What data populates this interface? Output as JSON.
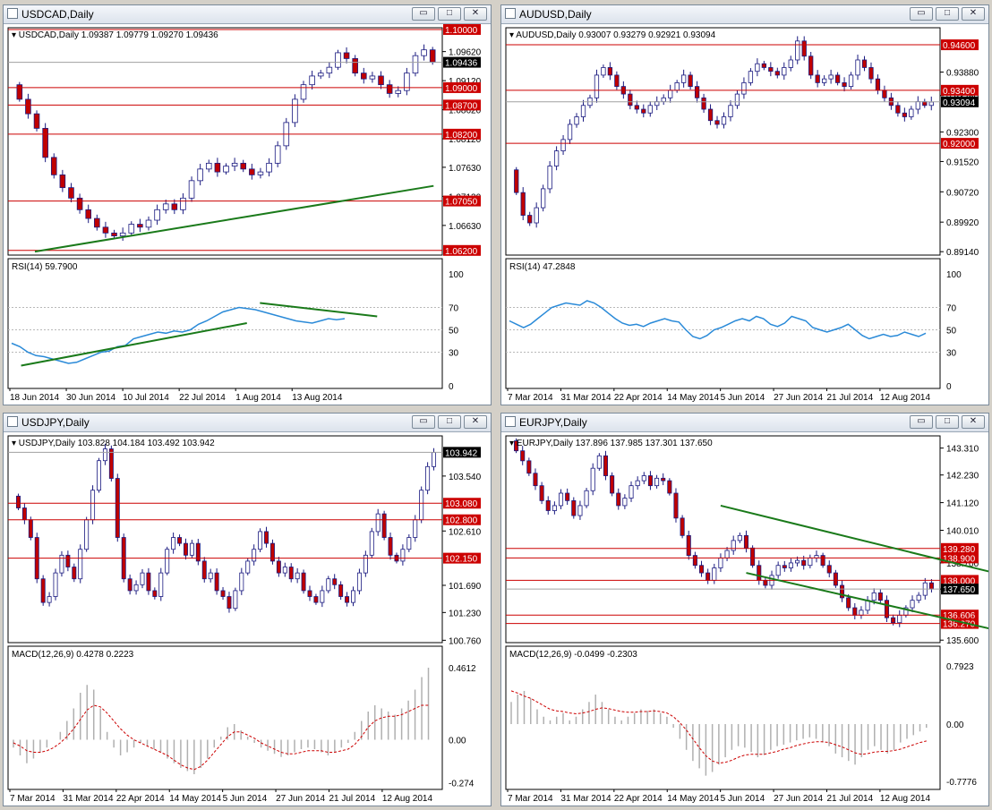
{
  "colors": {
    "level": "#cc0000",
    "bull_fill": "#ffffff",
    "bear_fill": "#c00000",
    "candle_stroke": "#1a1a80",
    "trend": "#1a7a1a",
    "rsi": "#2a8ad8",
    "signal": "#cc0000",
    "hist": "#b0b0b0",
    "price_label_bg": "#000000"
  },
  "window_buttons": {
    "minimize": "▭",
    "maximize": "□",
    "close": "✕"
  },
  "panels": [
    {
      "id": "usdcad",
      "title": "USDCAD,Daily",
      "legend": "USDCAD,Daily  1.09387 1.09779 1.09270 1.09436",
      "price_range": [
        1.0612,
        1.1003
      ],
      "ticks": [
        "1.09620",
        "1.09120",
        "1.08620",
        "1.08120",
        "1.07630",
        "1.07130",
        "1.06630"
      ],
      "tick_values": [
        1.0962,
        1.0912,
        1.0862,
        1.0812,
        1.0763,
        1.0713,
        1.0663
      ],
      "levels": [
        {
          "label": "1.10000",
          "value": 1.1
        },
        {
          "label": "1.09000",
          "value": 1.09
        },
        {
          "label": "1.08700",
          "value": 1.087
        },
        {
          "label": "1.08200",
          "value": 1.082
        },
        {
          "label": "1.07050",
          "value": 1.0705
        },
        {
          "label": "1.06200",
          "value": 1.062
        }
      ],
      "current": {
        "label": "1.09436",
        "value": 1.09436
      },
      "path": [
        1.088,
        1.0855,
        1.083,
        1.078,
        1.075,
        1.0728,
        1.071,
        1.069,
        1.0675,
        1.066,
        1.065,
        1.0645,
        1.065,
        1.0665,
        1.066,
        1.0672,
        1.069,
        1.07,
        1.069,
        1.071,
        1.074,
        1.076,
        1.077,
        1.0755,
        1.0765,
        1.077,
        1.076,
        1.075,
        1.0755,
        1.077,
        1.08,
        1.084,
        1.088,
        1.0905,
        1.092,
        1.0925,
        1.0935,
        1.096,
        1.095,
        1.0925,
        1.0915,
        1.092,
        1.0905,
        1.089,
        1.0895,
        1.0925,
        1.0955,
        1.0965,
        1.0944
      ],
      "trendlines": [
        {
          "p1": [
            5,
            1.0618
          ],
          "p2": [
            80,
            1.0731
          ]
        },
        {
          "p1": [
            0.03,
            "rsi",
            18
          ],
          "p2": [
            0.55,
            "rsi",
            56
          ],
          "sub": true
        },
        {
          "p1": [
            0.58,
            "rsi",
            74
          ],
          "p2": [
            0.85,
            "rsi",
            62
          ],
          "sub": true
        }
      ],
      "dates": [
        "18 Jun 2014",
        "30 Jun 2014",
        "10 Jul 2014",
        "22 Jul 2014",
        "1 Aug 2014",
        "13 Aug 2014"
      ],
      "sub": {
        "type": "rsi",
        "legend": "RSI(14) 59.7900",
        "ticks": [
          "100",
          "70",
          "50",
          "30",
          "0"
        ],
        "range": [
          0,
          100
        ],
        "values": [
          38,
          35,
          30,
          27,
          26,
          24,
          22,
          20,
          21,
          24,
          27,
          30,
          31,
          35,
          36,
          42,
          44,
          46,
          48,
          47,
          49,
          48,
          50,
          55,
          58,
          62,
          66,
          68,
          70,
          69,
          68,
          66,
          64,
          62,
          60,
          58,
          57,
          56,
          58,
          60,
          59,
          60
        ]
      }
    },
    {
      "id": "audusd",
      "title": "AUDUSD,Daily",
      "legend": "AUDUSD,Daily  0.93007 0.93279 0.92921 0.93094",
      "price_range": [
        0.8905,
        0.9505
      ],
      "ticks": [
        "0.93880",
        "0.93260",
        "0.92300",
        "0.91520",
        "0.90720",
        "0.89920",
        "0.89140"
      ],
      "tick_values": [
        0.9388,
        0.9326,
        0.923,
        0.9152,
        0.9072,
        0.8992,
        0.8914
      ],
      "levels": [
        {
          "label": "0.94600",
          "value": 0.946
        },
        {
          "label": "0.93400",
          "value": 0.934
        },
        {
          "label": "0.92000",
          "value": 0.92
        }
      ],
      "current": {
        "label": "0.93094",
        "value": 0.93094
      },
      "path": [
        0.907,
        0.901,
        0.899,
        0.903,
        0.908,
        0.914,
        0.918,
        0.921,
        0.925,
        0.927,
        0.93,
        0.932,
        0.938,
        0.94,
        0.938,
        0.935,
        0.933,
        0.93,
        0.929,
        0.928,
        0.93,
        0.931,
        0.932,
        0.934,
        0.936,
        0.938,
        0.935,
        0.932,
        0.929,
        0.926,
        0.925,
        0.927,
        0.93,
        0.933,
        0.936,
        0.939,
        0.941,
        0.94,
        0.939,
        0.938,
        0.94,
        0.942,
        0.947,
        0.943,
        0.938,
        0.936,
        0.937,
        0.938,
        0.936,
        0.935,
        0.938,
        0.942,
        0.94,
        0.937,
        0.934,
        0.932,
        0.93,
        0.928,
        0.927,
        0.929,
        0.931,
        0.93,
        0.9309
      ],
      "trendlines": [],
      "dates": [
        "7 Mar 2014",
        "31 Mar 2014",
        "22 Apr 2014",
        "14 May 2014",
        "5 Jun 2014",
        "27 Jun 2014",
        "21 Jul 2014",
        "12 Aug 2014"
      ],
      "sub": {
        "type": "rsi",
        "legend": "RSI(14) 47.2848",
        "ticks": [
          "100",
          "70",
          "50",
          "30",
          "0"
        ],
        "range": [
          0,
          100
        ],
        "values": [
          58,
          55,
          52,
          55,
          60,
          65,
          70,
          72,
          74,
          73,
          72,
          76,
          74,
          70,
          65,
          60,
          56,
          54,
          55,
          53,
          56,
          58,
          60,
          58,
          57,
          50,
          44,
          42,
          45,
          50,
          52,
          55,
          58,
          60,
          58,
          62,
          60,
          55,
          53,
          56,
          62,
          60,
          58,
          52,
          50,
          48,
          50,
          52,
          55,
          50,
          45,
          42,
          44,
          46,
          44,
          45,
          48,
          46,
          44,
          47
        ]
      }
    },
    {
      "id": "usdjpy",
      "title": "USDJPY,Daily",
      "legend": "USDJPY,Daily  103.828 104.184 103.492 103.942",
      "price_range": [
        100.72,
        104.22
      ],
      "ticks": [
        "103.540",
        "102.610",
        "101.690",
        "101.230",
        "100.760"
      ],
      "tick_values": [
        103.54,
        102.61,
        101.69,
        101.23,
        100.76
      ],
      "levels": [
        {
          "label": "103.080",
          "value": 103.08
        },
        {
          "label": "102.800",
          "value": 102.8
        },
        {
          "label": "102.150",
          "value": 102.15
        }
      ],
      "current": {
        "label": "103.942",
        "value": 103.942
      },
      "path": [
        103.0,
        102.8,
        102.5,
        101.8,
        101.4,
        101.5,
        101.9,
        102.2,
        102.0,
        101.8,
        102.3,
        102.8,
        103.3,
        103.8,
        104.0,
        103.5,
        102.5,
        101.8,
        101.6,
        101.7,
        101.9,
        101.6,
        101.5,
        101.9,
        102.3,
        102.5,
        102.4,
        102.2,
        102.4,
        102.1,
        101.8,
        101.9,
        101.6,
        101.5,
        101.3,
        101.6,
        101.9,
        102.1,
        102.3,
        102.6,
        102.4,
        102.1,
        101.9,
        102.0,
        101.8,
        101.9,
        101.6,
        101.5,
        101.4,
        101.6,
        101.8,
        101.7,
        101.5,
        101.4,
        101.6,
        101.9,
        102.2,
        102.6,
        102.9,
        102.5,
        102.2,
        102.1,
        102.3,
        102.5,
        102.8,
        103.3,
        103.7,
        103.94
      ],
      "trendlines": [],
      "dates": [
        "7 Mar 2014",
        "31 Mar 2014",
        "22 Apr 2014",
        "14 May 2014",
        "5 Jun 2014",
        "27 Jun 2014",
        "21 Jul 2014",
        "12 Aug 2014"
      ],
      "sub": {
        "type": "macd",
        "legend": "MACD(12,26,9) 0.4278 0.2223",
        "ticks": [
          "0.4612",
          "0.00",
          "-0.274"
        ],
        "tick_values": [
          0.4612,
          0.0,
          -0.274
        ],
        "range": [
          -0.3,
          0.5
        ],
        "hist": [
          -0.05,
          -0.1,
          -0.15,
          -0.12,
          -0.08,
          -0.05,
          0.0,
          0.05,
          0.12,
          0.2,
          0.3,
          0.35,
          0.32,
          0.2,
          0.05,
          -0.05,
          -0.1,
          -0.08,
          -0.05,
          -0.02,
          -0.04,
          -0.06,
          -0.08,
          -0.12,
          -0.15,
          -0.18,
          -0.2,
          -0.22,
          -0.18,
          -0.12,
          -0.05,
          0.02,
          0.08,
          0.1,
          0.06,
          0.02,
          -0.02,
          -0.05,
          -0.07,
          -0.09,
          -0.11,
          -0.1,
          -0.08,
          -0.06,
          -0.05,
          -0.06,
          -0.08,
          -0.1,
          -0.08,
          -0.05,
          -0.02,
          0.05,
          0.12,
          0.18,
          0.22,
          0.2,
          0.18,
          0.16,
          0.2,
          0.25,
          0.32,
          0.4,
          0.46
        ],
        "signal": [
          -0.02,
          -0.04,
          -0.07,
          -0.08,
          -0.08,
          -0.07,
          -0.05,
          -0.02,
          0.02,
          0.07,
          0.13,
          0.19,
          0.22,
          0.21,
          0.17,
          0.12,
          0.07,
          0.03,
          0.0,
          -0.02,
          -0.04,
          -0.06,
          -0.08,
          -0.1,
          -0.13,
          -0.16,
          -0.18,
          -0.19,
          -0.17,
          -0.13,
          -0.08,
          -0.03,
          0.02,
          0.05,
          0.05,
          0.03,
          0.01,
          -0.02,
          -0.04,
          -0.06,
          -0.08,
          -0.09,
          -0.09,
          -0.08,
          -0.07,
          -0.07,
          -0.07,
          -0.08,
          -0.08,
          -0.07,
          -0.06,
          -0.03,
          0.02,
          0.08,
          0.12,
          0.14,
          0.15,
          0.15,
          0.16,
          0.18,
          0.2,
          0.22,
          0.22
        ]
      }
    },
    {
      "id": "eurjpy",
      "title": "EURJPY,Daily",
      "legend": "EURJPY,Daily  137.896 137.985 137.301 137.650",
      "price_range": [
        135.5,
        143.8
      ],
      "ticks": [
        "143.310",
        "142.230",
        "141.120",
        "140.010",
        "138.700",
        "137.650",
        "135.600"
      ],
      "tick_values": [
        143.31,
        142.23,
        141.12,
        140.01,
        138.7,
        137.65,
        135.6
      ],
      "levels": [
        {
          "label": "139.280",
          "value": 139.28
        },
        {
          "label": "138.900",
          "value": 138.9
        },
        {
          "label": "138.000",
          "value": 138.0
        },
        {
          "label": "136.606",
          "value": 136.606
        },
        {
          "label": "136.270",
          "value": 136.27
        }
      ],
      "current": {
        "label": "137.650",
        "value": 137.65
      },
      "path": [
        143.2,
        142.8,
        142.3,
        141.8,
        141.2,
        140.8,
        141.0,
        141.5,
        141.2,
        140.6,
        141.0,
        141.6,
        142.5,
        143.0,
        142.2,
        141.5,
        141.0,
        141.3,
        141.8,
        142.0,
        142.2,
        141.8,
        142.1,
        142.0,
        141.5,
        140.5,
        139.8,
        139.0,
        138.6,
        138.3,
        138.0,
        138.5,
        138.9,
        139.2,
        139.6,
        139.8,
        139.3,
        138.6,
        138.0,
        137.8,
        138.2,
        138.6,
        138.5,
        138.7,
        138.8,
        138.6,
        138.9,
        139.0,
        138.6,
        138.3,
        137.8,
        137.3,
        136.9,
        136.6,
        136.8,
        137.2,
        137.5,
        137.2,
        136.5,
        136.3,
        136.6,
        136.9,
        137.2,
        137.4,
        137.9,
        137.65
      ],
      "trendlines": [
        {
          "p1": [
            32,
            141.0
          ],
          "p2": [
            82,
            137.85
          ]
        },
        {
          "p1": [
            36,
            138.3
          ],
          "p2": [
            82,
            135.6
          ]
        }
      ],
      "dates": [
        "7 Mar 2014",
        "31 Mar 2014",
        "22 Apr 2014",
        "14 May 2014",
        "5 Jun 2014",
        "27 Jun 2014",
        "21 Jul 2014",
        "12 Aug 2014"
      ],
      "sub": {
        "type": "macd",
        "legend": "MACD(12,26,9) -0.0499 -0.2303",
        "ticks": [
          "0.7923",
          "0.00",
          "-0.7776"
        ],
        "tick_values": [
          0.7923,
          0.0,
          -0.7776
        ],
        "range": [
          -0.85,
          0.85
        ],
        "hist": [
          0.3,
          0.4,
          0.45,
          0.35,
          0.2,
          0.1,
          0.05,
          0.1,
          0.15,
          0.05,
          0.1,
          0.2,
          0.3,
          0.4,
          0.3,
          0.2,
          0.1,
          0.05,
          0.1,
          0.15,
          0.2,
          0.18,
          0.2,
          0.15,
          0.1,
          -0.05,
          -0.2,
          -0.35,
          -0.5,
          -0.6,
          -0.7,
          -0.65,
          -0.55,
          -0.45,
          -0.35,
          -0.3,
          -0.32,
          -0.38,
          -0.45,
          -0.42,
          -0.35,
          -0.3,
          -0.28,
          -0.25,
          -0.22,
          -0.2,
          -0.18,
          -0.2,
          -0.25,
          -0.3,
          -0.4,
          -0.45,
          -0.5,
          -0.55,
          -0.45,
          -0.35,
          -0.3,
          -0.35,
          -0.4,
          -0.35,
          -0.25,
          -0.2,
          -0.15,
          -0.1,
          -0.05
        ],
        "signal": [
          0.45,
          0.42,
          0.38,
          0.35,
          0.3,
          0.25,
          0.2,
          0.18,
          0.17,
          0.15,
          0.14,
          0.15,
          0.17,
          0.2,
          0.22,
          0.21,
          0.19,
          0.17,
          0.16,
          0.16,
          0.17,
          0.17,
          0.18,
          0.17,
          0.15,
          0.1,
          0.02,
          -0.08,
          -0.2,
          -0.32,
          -0.43,
          -0.5,
          -0.53,
          -0.52,
          -0.49,
          -0.45,
          -0.42,
          -0.41,
          -0.41,
          -0.41,
          -0.39,
          -0.37,
          -0.34,
          -0.32,
          -0.29,
          -0.27,
          -0.25,
          -0.24,
          -0.24,
          -0.25,
          -0.28,
          -0.31,
          -0.35,
          -0.39,
          -0.41,
          -0.4,
          -0.38,
          -0.37,
          -0.37,
          -0.36,
          -0.34,
          -0.31,
          -0.28,
          -0.25,
          -0.23
        ]
      }
    }
  ]
}
